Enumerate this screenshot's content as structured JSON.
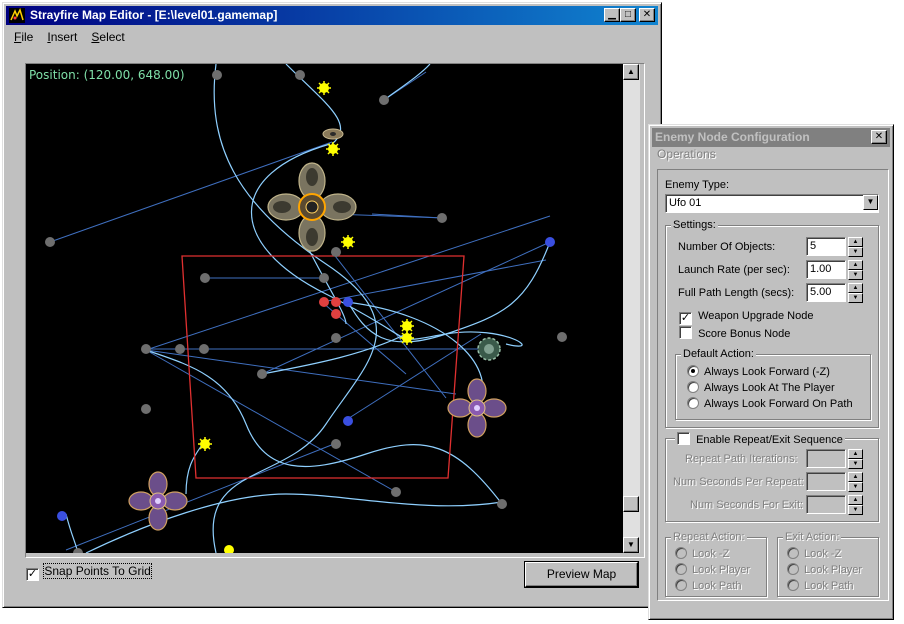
{
  "main_window": {
    "title": "Strayfire Map Editor - [E:\\level01.gamemap]",
    "menu": [
      "File",
      "Insert",
      "Select"
    ],
    "position_label": "Position: (120.00, 648.00)",
    "snap_label": "Snap Points To Grid",
    "snap_checked": true,
    "preview_label": "Preview Map"
  },
  "dialog": {
    "title": "Enemy Node Configuration",
    "menu": "Operations",
    "enemy_type_label": "Enemy Type:",
    "enemy_type_value": "Ufo 01",
    "settings_label": "Settings:",
    "num_objects_label": "Number Of Objects:",
    "num_objects_value": "5",
    "launch_rate_label": "Launch Rate (per sec):",
    "launch_rate_value": "1.00",
    "path_length_label": "Full Path Length (secs):",
    "path_length_value": "5.00",
    "weapon_upgrade_label": "Weapon Upgrade Node",
    "weapon_upgrade_checked": true,
    "score_bonus_label": "Score Bonus Node",
    "score_bonus_checked": false,
    "default_action_label": "Default Action:",
    "default_actions": [
      "Always Look Forward (-Z)",
      "Always Look At The Player",
      "Always Look Forward On Path"
    ],
    "default_action_selected": 0,
    "repeat_label": "Enable Repeat/Exit Sequence",
    "repeat_iterations_label": "Repeat Path Iterations:",
    "seconds_per_repeat_label": "Num Seconds Per Repeat:",
    "seconds_for_exit_label": "Num Seconds For Exit:",
    "repeat_action_label": "Repeat Action:",
    "exit_action_label": "Exit Action:",
    "action_options": [
      "Look -Z",
      "Look Player",
      "Look Path"
    ]
  },
  "colors": {
    "title_active": "#000080",
    "title_inactive": "#808080",
    "canvas_bg": "#000000",
    "position_text": "#7fe0a8",
    "path_line": "#8fd0ff",
    "grid_line": "#3f6fbf",
    "node_gray": "#6e6e6e",
    "node_blue": "#3a4fe0",
    "node_red": "#e04040",
    "node_yellow": "#ffff00",
    "boundary": "#e03030"
  },
  "icons": [
    "app-icon",
    "minimize-icon",
    "maximize-icon",
    "close-icon",
    "scroll-up-icon",
    "scroll-down-icon",
    "dropdown-arrow-icon",
    "spin-up-icon",
    "spin-down-icon",
    "check-icon"
  ]
}
